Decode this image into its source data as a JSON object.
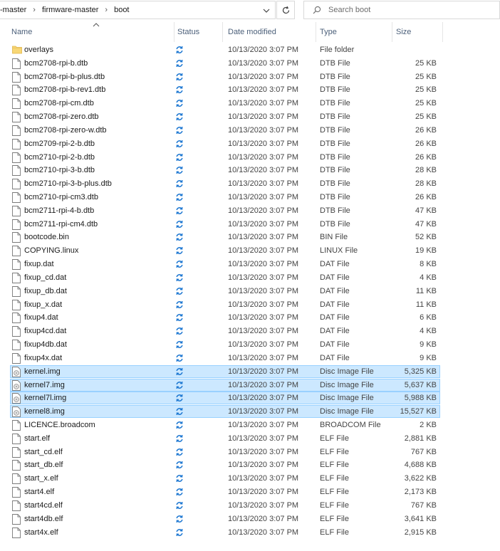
{
  "address_bar": {
    "crumbs": [
      "-master",
      "firmware-master",
      "boot"
    ]
  },
  "search": {
    "placeholder": "Search boot"
  },
  "columns": {
    "name": "Name",
    "status": "Status",
    "date": "Date modified",
    "type": "Type",
    "size": "Size"
  },
  "icons": {
    "folder": "folder-icon",
    "file": "file-icon",
    "disc": "disc-image-icon",
    "status": "sync-status-icon"
  },
  "colors": {
    "selection": "#cce8ff",
    "selection_border": "#99d1ff",
    "status_blue": "#1e78d2",
    "folder_yellow": "#f8d775"
  },
  "files": [
    {
      "name": "overlays",
      "date": "10/13/2020 3:07 PM",
      "type": "File folder",
      "size": "",
      "icon": "folder",
      "selected": false
    },
    {
      "name": "bcm2708-rpi-b.dtb",
      "date": "10/13/2020 3:07 PM",
      "type": "DTB File",
      "size": "25 KB",
      "icon": "file",
      "selected": false
    },
    {
      "name": "bcm2708-rpi-b-plus.dtb",
      "date": "10/13/2020 3:07 PM",
      "type": "DTB File",
      "size": "25 KB",
      "icon": "file",
      "selected": false
    },
    {
      "name": "bcm2708-rpi-b-rev1.dtb",
      "date": "10/13/2020 3:07 PM",
      "type": "DTB File",
      "size": "25 KB",
      "icon": "file",
      "selected": false
    },
    {
      "name": "bcm2708-rpi-cm.dtb",
      "date": "10/13/2020 3:07 PM",
      "type": "DTB File",
      "size": "25 KB",
      "icon": "file",
      "selected": false
    },
    {
      "name": "bcm2708-rpi-zero.dtb",
      "date": "10/13/2020 3:07 PM",
      "type": "DTB File",
      "size": "25 KB",
      "icon": "file",
      "selected": false
    },
    {
      "name": "bcm2708-rpi-zero-w.dtb",
      "date": "10/13/2020 3:07 PM",
      "type": "DTB File",
      "size": "26 KB",
      "icon": "file",
      "selected": false
    },
    {
      "name": "bcm2709-rpi-2-b.dtb",
      "date": "10/13/2020 3:07 PM",
      "type": "DTB File",
      "size": "26 KB",
      "icon": "file",
      "selected": false
    },
    {
      "name": "bcm2710-rpi-2-b.dtb",
      "date": "10/13/2020 3:07 PM",
      "type": "DTB File",
      "size": "26 KB",
      "icon": "file",
      "selected": false
    },
    {
      "name": "bcm2710-rpi-3-b.dtb",
      "date": "10/13/2020 3:07 PM",
      "type": "DTB File",
      "size": "28 KB",
      "icon": "file",
      "selected": false
    },
    {
      "name": "bcm2710-rpi-3-b-plus.dtb",
      "date": "10/13/2020 3:07 PM",
      "type": "DTB File",
      "size": "28 KB",
      "icon": "file",
      "selected": false
    },
    {
      "name": "bcm2710-rpi-cm3.dtb",
      "date": "10/13/2020 3:07 PM",
      "type": "DTB File",
      "size": "26 KB",
      "icon": "file",
      "selected": false
    },
    {
      "name": "bcm2711-rpi-4-b.dtb",
      "date": "10/13/2020 3:07 PM",
      "type": "DTB File",
      "size": "47 KB",
      "icon": "file",
      "selected": false
    },
    {
      "name": "bcm2711-rpi-cm4.dtb",
      "date": "10/13/2020 3:07 PM",
      "type": "DTB File",
      "size": "47 KB",
      "icon": "file",
      "selected": false
    },
    {
      "name": "bootcode.bin",
      "date": "10/13/2020 3:07 PM",
      "type": "BIN File",
      "size": "52 KB",
      "icon": "file",
      "selected": false
    },
    {
      "name": "COPYING.linux",
      "date": "10/13/2020 3:07 PM",
      "type": "LINUX File",
      "size": "19 KB",
      "icon": "file",
      "selected": false
    },
    {
      "name": "fixup.dat",
      "date": "10/13/2020 3:07 PM",
      "type": "DAT File",
      "size": "8 KB",
      "icon": "file",
      "selected": false
    },
    {
      "name": "fixup_cd.dat",
      "date": "10/13/2020 3:07 PM",
      "type": "DAT File",
      "size": "4 KB",
      "icon": "file",
      "selected": false
    },
    {
      "name": "fixup_db.dat",
      "date": "10/13/2020 3:07 PM",
      "type": "DAT File",
      "size": "11 KB",
      "icon": "file",
      "selected": false
    },
    {
      "name": "fixup_x.dat",
      "date": "10/13/2020 3:07 PM",
      "type": "DAT File",
      "size": "11 KB",
      "icon": "file",
      "selected": false
    },
    {
      "name": "fixup4.dat",
      "date": "10/13/2020 3:07 PM",
      "type": "DAT File",
      "size": "6 KB",
      "icon": "file",
      "selected": false
    },
    {
      "name": "fixup4cd.dat",
      "date": "10/13/2020 3:07 PM",
      "type": "DAT File",
      "size": "4 KB",
      "icon": "file",
      "selected": false
    },
    {
      "name": "fixup4db.dat",
      "date": "10/13/2020 3:07 PM",
      "type": "DAT File",
      "size": "9 KB",
      "icon": "file",
      "selected": false
    },
    {
      "name": "fixup4x.dat",
      "date": "10/13/2020 3:07 PM",
      "type": "DAT File",
      "size": "9 KB",
      "icon": "file",
      "selected": false
    },
    {
      "name": "kernel.img",
      "date": "10/13/2020 3:07 PM",
      "type": "Disc Image File",
      "size": "5,325 KB",
      "icon": "disc",
      "selected": true
    },
    {
      "name": "kernel7.img",
      "date": "10/13/2020 3:07 PM",
      "type": "Disc Image File",
      "size": "5,637 KB",
      "icon": "disc",
      "selected": true
    },
    {
      "name": "kernel7l.img",
      "date": "10/13/2020 3:07 PM",
      "type": "Disc Image File",
      "size": "5,988 KB",
      "icon": "disc",
      "selected": true
    },
    {
      "name": "kernel8.img",
      "date": "10/13/2020 3:07 PM",
      "type": "Disc Image File",
      "size": "15,527 KB",
      "icon": "disc",
      "selected": true
    },
    {
      "name": "LICENCE.broadcom",
      "date": "10/13/2020 3:07 PM",
      "type": "BROADCOM File",
      "size": "2 KB",
      "icon": "file",
      "selected": false
    },
    {
      "name": "start.elf",
      "date": "10/13/2020 3:07 PM",
      "type": "ELF File",
      "size": "2,881 KB",
      "icon": "file",
      "selected": false
    },
    {
      "name": "start_cd.elf",
      "date": "10/13/2020 3:07 PM",
      "type": "ELF File",
      "size": "767 KB",
      "icon": "file",
      "selected": false
    },
    {
      "name": "start_db.elf",
      "date": "10/13/2020 3:07 PM",
      "type": "ELF File",
      "size": "4,688 KB",
      "icon": "file",
      "selected": false
    },
    {
      "name": "start_x.elf",
      "date": "10/13/2020 3:07 PM",
      "type": "ELF File",
      "size": "3,622 KB",
      "icon": "file",
      "selected": false
    },
    {
      "name": "start4.elf",
      "date": "10/13/2020 3:07 PM",
      "type": "ELF File",
      "size": "2,173 KB",
      "icon": "file",
      "selected": false
    },
    {
      "name": "start4cd.elf",
      "date": "10/13/2020 3:07 PM",
      "type": "ELF File",
      "size": "767 KB",
      "icon": "file",
      "selected": false
    },
    {
      "name": "start4db.elf",
      "date": "10/13/2020 3:07 PM",
      "type": "ELF File",
      "size": "3,641 KB",
      "icon": "file",
      "selected": false
    },
    {
      "name": "start4x.elf",
      "date": "10/13/2020 3:07 PM",
      "type": "ELF File",
      "size": "2,915 KB",
      "icon": "file",
      "selected": false
    }
  ]
}
